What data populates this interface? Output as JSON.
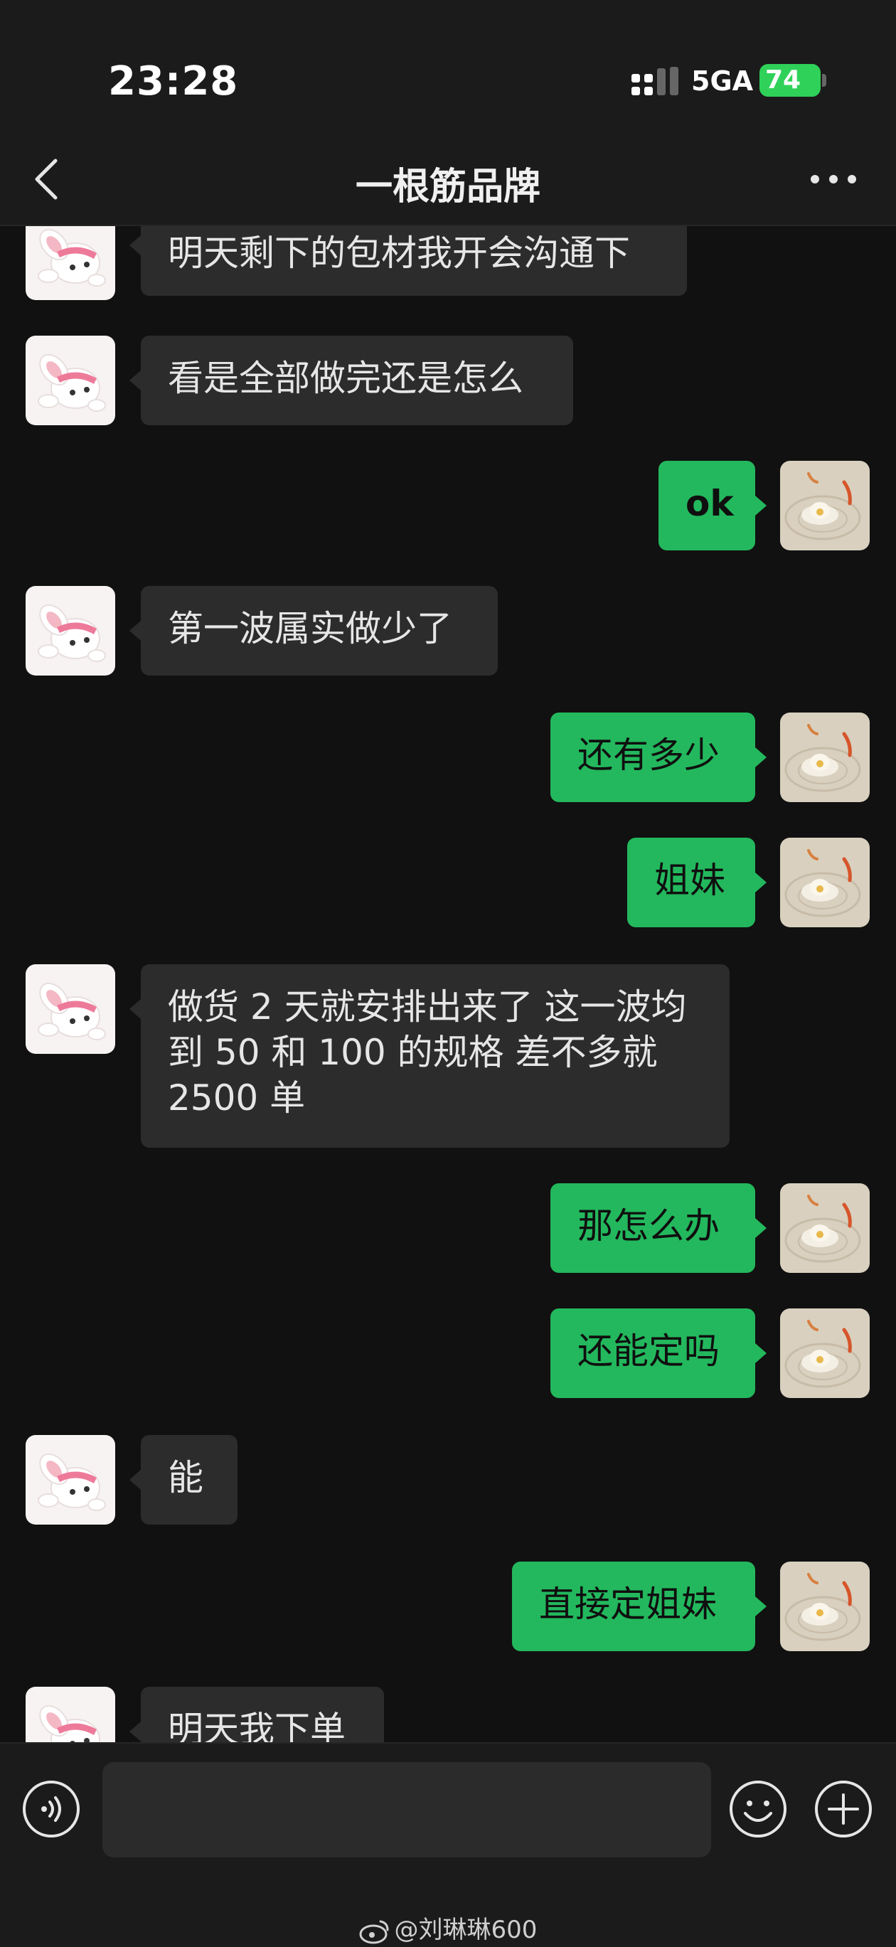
{
  "status_bar": {
    "time": "23:28",
    "network": "5GA",
    "battery": "74"
  },
  "header": {
    "title": "一根筋品牌"
  },
  "messages": [
    {
      "side": "in",
      "text": "明天剩下的包材我开会沟通下"
    },
    {
      "side": "in",
      "text": "看是全部做完还是怎么"
    },
    {
      "side": "out",
      "text": "ok"
    },
    {
      "side": "in",
      "text": "第一波属实做少了"
    },
    {
      "side": "out",
      "text": "还有多少"
    },
    {
      "side": "out",
      "text": "姐妹"
    },
    {
      "side": "in",
      "lines": [
        "做货 2 天就安排出来了 这一波均",
        "到 50 和 100 的规格 差不多就",
        "2500 单"
      ]
    },
    {
      "side": "out",
      "text": "那怎么办"
    },
    {
      "side": "out",
      "text": "还能定吗"
    },
    {
      "side": "in",
      "text": "能"
    },
    {
      "side": "out",
      "text": "直接定姐妹"
    },
    {
      "side": "in",
      "text": "明天我下单"
    }
  ],
  "input": {
    "placeholder": ""
  },
  "watermark": {
    "text": "@刘琳琳600"
  },
  "colors": {
    "bubble_in": "#2c2c2c",
    "bubble_out": "#23b85d",
    "background": "#111111"
  }
}
